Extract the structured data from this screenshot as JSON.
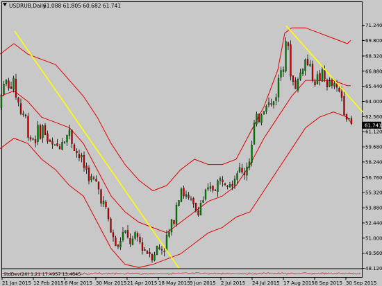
{
  "header": {
    "symbol": "USDRUB,Daily",
    "ohlc": "61.088 61.805 60.682 61.741"
  },
  "indicator": {
    "label": "StdDev(20) 1.21 17.4957 13.4645"
  },
  "price_label": "61.741",
  "colors": {
    "background": "#c8c8c8",
    "bull": "#008800",
    "bear": "#cc0000",
    "band": "#dd0000",
    "trendline": "#ffff00",
    "price_tag": "#000000"
  },
  "chart_data": {
    "type": "candlestick",
    "title": "USDRUB,Daily",
    "ylim": [
      48.122,
      72.2
    ],
    "y_ticks": [
      "71.240",
      "69.800",
      "68.320",
      "66.880",
      "65.440",
      "64.000",
      "62.560",
      "61.120",
      "59.680",
      "58.240",
      "56.760",
      "55.320",
      "53.880",
      "52.440",
      "51.000",
      "49.560",
      "48.120"
    ],
    "x_ticks": [
      "21 Jan 2015",
      "12 Feb 2015",
      "6 Mar 2015",
      "30 Mar 2015",
      "21 Apr 2015",
      "18 May 2015",
      "9 Jun 2015",
      "2 Jul 2015",
      "24 Jul 2015",
      "17 Aug 2015",
      "8 Sep 2015",
      "30 Sep 2015"
    ],
    "last_price": 61.741,
    "price_path": [
      [
        0,
        63.5
      ],
      [
        6,
        66.5
      ],
      [
        12,
        65.0
      ],
      [
        18,
        66.0
      ],
      [
        24,
        64.5
      ],
      [
        30,
        63.0
      ],
      [
        36,
        62.8
      ],
      [
        40,
        61.0
      ],
      [
        48,
        60.5
      ],
      [
        56,
        61.0
      ],
      [
        62,
        61.5
      ],
      [
        70,
        60.0
      ],
      [
        80,
        59.5
      ],
      [
        90,
        60.5
      ],
      [
        100,
        61.0
      ],
      [
        108,
        59.5
      ],
      [
        116,
        58.5
      ],
      [
        124,
        57.5
      ],
      [
        132,
        56.5
      ],
      [
        140,
        56.0
      ],
      [
        148,
        54.5
      ],
      [
        155,
        53.0
      ],
      [
        160,
        51.5
      ],
      [
        165,
        50.5
      ],
      [
        170,
        50.0
      ],
      [
        176,
        51.5
      ],
      [
        182,
        51.0
      ],
      [
        190,
        50.5
      ],
      [
        198,
        51.0
      ],
      [
        206,
        50.0
      ],
      [
        212,
        49.8
      ],
      [
        220,
        49.5
      ],
      [
        226,
        50.0
      ],
      [
        232,
        50.0
      ],
      [
        238,
        50.5
      ],
      [
        244,
        51.5
      ],
      [
        250,
        53.0
      ],
      [
        256,
        55.0
      ],
      [
        260,
        56.0
      ],
      [
        266,
        55.0
      ],
      [
        272,
        54.5
      ],
      [
        278,
        54.0
      ],
      [
        284,
        53.5
      ],
      [
        290,
        54.5
      ],
      [
        296,
        55.0
      ],
      [
        302,
        55.5
      ],
      [
        310,
        56.0
      ],
      [
        318,
        56.5
      ],
      [
        326,
        57.0
      ],
      [
        334,
        56.5
      ],
      [
        342,
        57.5
      ],
      [
        350,
        57.0
      ],
      [
        356,
        58.0
      ],
      [
        362,
        59.5
      ],
      [
        366,
        61.5
      ],
      [
        370,
        62.0
      ],
      [
        376,
        63.0
      ],
      [
        384,
        64.0
      ],
      [
        392,
        63.5
      ],
      [
        398,
        65.0
      ],
      [
        404,
        67.0
      ],
      [
        408,
        68.0
      ],
      [
        412,
        70.5
      ],
      [
        416,
        68.0
      ],
      [
        420,
        66.0
      ],
      [
        426,
        65.5
      ],
      [
        432,
        66.5
      ],
      [
        438,
        68.0
      ],
      [
        444,
        67.5
      ],
      [
        450,
        66.5
      ],
      [
        456,
        66.0
      ],
      [
        462,
        66.5
      ],
      [
        468,
        66.0
      ],
      [
        474,
        65.5
      ],
      [
        480,
        65.5
      ],
      [
        486,
        65.0
      ],
      [
        492,
        64.5
      ],
      [
        496,
        63.5
      ],
      [
        500,
        62.5
      ],
      [
        504,
        61.5
      ],
      [
        506,
        61.741
      ]
    ],
    "bands": {
      "upper": [
        [
          0,
          68.5
        ],
        [
          20,
          69.5
        ],
        [
          40,
          68.5
        ],
        [
          60,
          68.0
        ],
        [
          80,
          67.5
        ],
        [
          100,
          66.0
        ],
        [
          120,
          64.5
        ],
        [
          140,
          62.5
        ],
        [
          160,
          60.0
        ],
        [
          180,
          58.0
        ],
        [
          200,
          56.5
        ],
        [
          220,
          55.5
        ],
        [
          240,
          56.0
        ],
        [
          260,
          57.5
        ],
        [
          280,
          58.5
        ],
        [
          300,
          58.0
        ],
        [
          320,
          58.0
        ],
        [
          340,
          58.5
        ],
        [
          360,
          61.0
        ],
        [
          380,
          63.5
        ],
        [
          400,
          67.0
        ],
        [
          410,
          70.5
        ],
        [
          420,
          71.0
        ],
        [
          440,
          71.0
        ],
        [
          460,
          70.5
        ],
        [
          480,
          70.0
        ],
        [
          500,
          69.5
        ],
        [
          505,
          69.8
        ]
      ],
      "middle": [
        [
          0,
          64.5
        ],
        [
          20,
          65.0
        ],
        [
          40,
          64.0
        ],
        [
          60,
          62.5
        ],
        [
          80,
          62.0
        ],
        [
          100,
          61.5
        ],
        [
          120,
          60.0
        ],
        [
          140,
          57.5
        ],
        [
          160,
          55.0
        ],
        [
          180,
          53.5
        ],
        [
          200,
          52.5
        ],
        [
          220,
          52.0
        ],
        [
          240,
          51.5
        ],
        [
          260,
          52.5
        ],
        [
          280,
          53.5
        ],
        [
          300,
          54.5
        ],
        [
          320,
          55.0
        ],
        [
          340,
          56.0
        ],
        [
          360,
          58.0
        ],
        [
          380,
          60.5
        ],
        [
          400,
          62.5
        ],
        [
          420,
          64.5
        ],
        [
          440,
          66.0
        ],
        [
          460,
          66.0
        ],
        [
          480,
          66.0
        ],
        [
          500,
          65.5
        ],
        [
          505,
          65.5
        ]
      ],
      "lower": [
        [
          0,
          59.5
        ],
        [
          20,
          60.5
        ],
        [
          40,
          60.0
        ],
        [
          60,
          58.5
        ],
        [
          80,
          57.5
        ],
        [
          100,
          56.0
        ],
        [
          120,
          55.0
        ],
        [
          140,
          52.5
        ],
        [
          160,
          50.0
        ],
        [
          180,
          48.5
        ],
        [
          200,
          48.2
        ],
        [
          220,
          48.5
        ],
        [
          240,
          49.0
        ],
        [
          260,
          49.5
        ],
        [
          280,
          50.5
        ],
        [
          300,
          51.5
        ],
        [
          320,
          52.0
        ],
        [
          340,
          53.0
        ],
        [
          360,
          53.5
        ],
        [
          380,
          55.5
        ],
        [
          400,
          57.5
        ],
        [
          420,
          59.5
        ],
        [
          440,
          61.5
        ],
        [
          460,
          62.5
        ],
        [
          480,
          63.0
        ],
        [
          500,
          62.5
        ],
        [
          505,
          62.0
        ]
      ]
    },
    "trendlines": [
      {
        "from": [
          21,
          70.7
        ],
        "to": [
          258,
          48.1
        ]
      },
      {
        "from": [
          412,
          71.2
        ],
        "to": [
          522,
          63.0
        ]
      }
    ]
  }
}
